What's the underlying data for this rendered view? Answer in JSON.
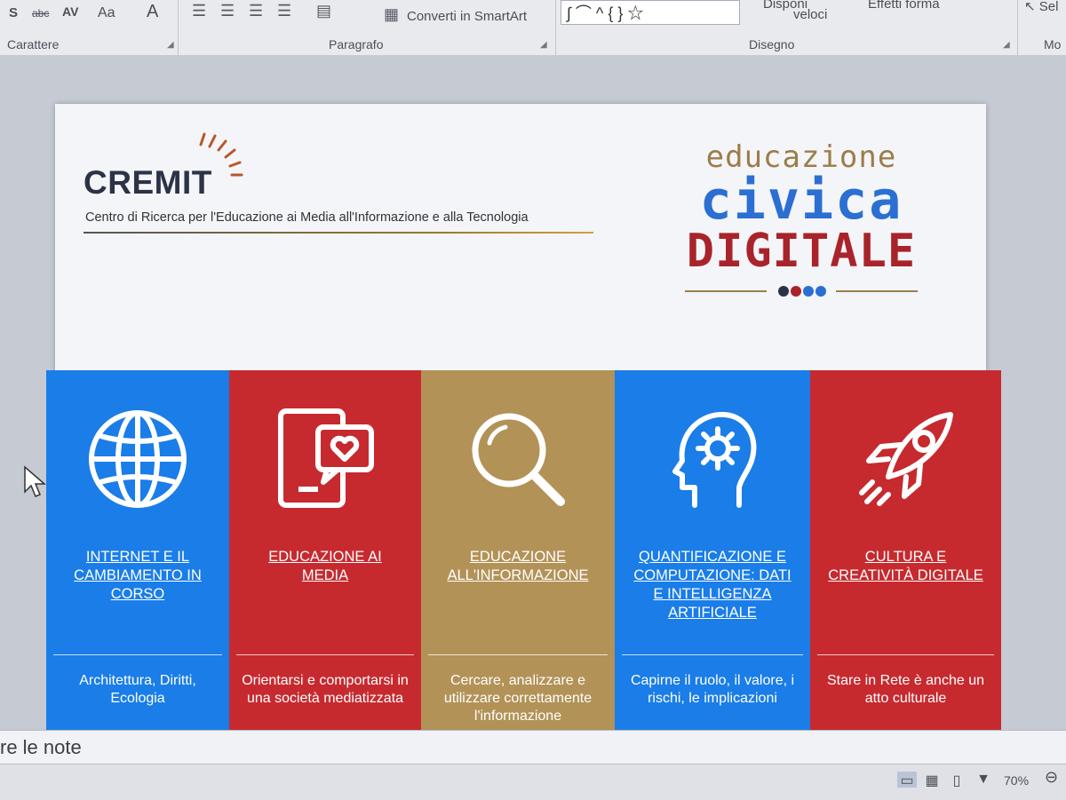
{
  "ribbon": {
    "groups": {
      "font": {
        "label": "Carattere"
      },
      "paragraph": {
        "label": "Paragrafo",
        "smartart_label": "Converti in SmartArt"
      },
      "drawing": {
        "label": "Disegno",
        "arrange_label": "Disponi",
        "quick_styles_label": "veloci",
        "shape_effects_label": "Effetti forma"
      },
      "editing": {
        "label": "Mo",
        "select_label": "Sel"
      }
    },
    "font_buttons": [
      "S",
      "abc",
      "AV",
      "Aa",
      "A"
    ]
  },
  "slide": {
    "cremit": {
      "name": "CREMIT",
      "subtitle": "Centro di Ricerca per l'Educazione ai Media all'Informazione e alla Tecnologia"
    },
    "edu_logo": {
      "line1": "educazione",
      "line2": "civica",
      "line3": "DIGITALE"
    },
    "columns": [
      {
        "color": "#1a7de8",
        "icon": "globe-icon",
        "title": "INTERNET E IL CAMBIAMENTO IN CORSO",
        "desc": "Architettura, Diritti, Ecologia"
      },
      {
        "color": "#c62a2f",
        "icon": "tablet-heart-icon",
        "title": "EDUCAZIONE AI MEDIA",
        "desc": "Orientarsi e comportarsi in una società mediatizzata"
      },
      {
        "color": "#b39257",
        "icon": "magnifier-icon",
        "title": "EDUCAZIONE ALL'INFORMAZIONE",
        "desc": "Cercare, analizzare e utilizzare correttamente l'informazione"
      },
      {
        "color": "#1a7de8",
        "icon": "head-gear-icon",
        "title": "QUANTIFICAZIONE E COMPUTAZIONE: DATI E INTELLIGENZA ARTIFICIALE",
        "desc": "Capirne il ruolo, il valore, i rischi, le implicazioni"
      },
      {
        "color": "#c62a2f",
        "icon": "rocket-icon",
        "title": "CULTURA E CREATIVITÀ DIGITALE",
        "desc": "Stare in Rete è anche un atto culturale"
      }
    ]
  },
  "notes": {
    "placeholder": "re le note"
  },
  "status": {
    "zoom": "70%"
  },
  "colors": {
    "blue": "#1a7de8",
    "red": "#c62a2f",
    "gold": "#b39257"
  }
}
